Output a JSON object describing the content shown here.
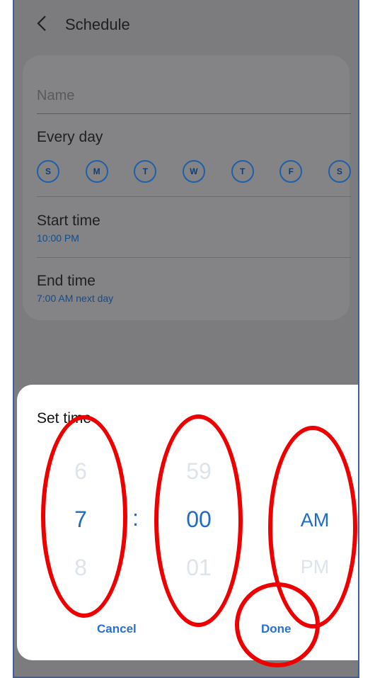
{
  "header": {
    "title": "Schedule"
  },
  "form": {
    "name_placeholder": "Name",
    "repeat_label": "Every day",
    "days": [
      "S",
      "M",
      "T",
      "W",
      "T",
      "F",
      "S"
    ],
    "start_time": {
      "label": "Start time",
      "value": "10:00 PM"
    },
    "end_time": {
      "label": "End time",
      "value": "7:00 AM next day"
    }
  },
  "picker": {
    "title": "Set time",
    "hour": {
      "prev": "6",
      "selected": "7",
      "next": "8"
    },
    "separator": ":",
    "minute": {
      "prev": "59",
      "selected": "00",
      "next": "01"
    },
    "ampm": {
      "selected": "AM",
      "next": "PM"
    },
    "cancel_label": "Cancel",
    "done_label": "Done"
  },
  "colors": {
    "accent": "#1e6cc6",
    "annotation": "#ee0000",
    "dim_overlay": "#7c7c7f"
  }
}
